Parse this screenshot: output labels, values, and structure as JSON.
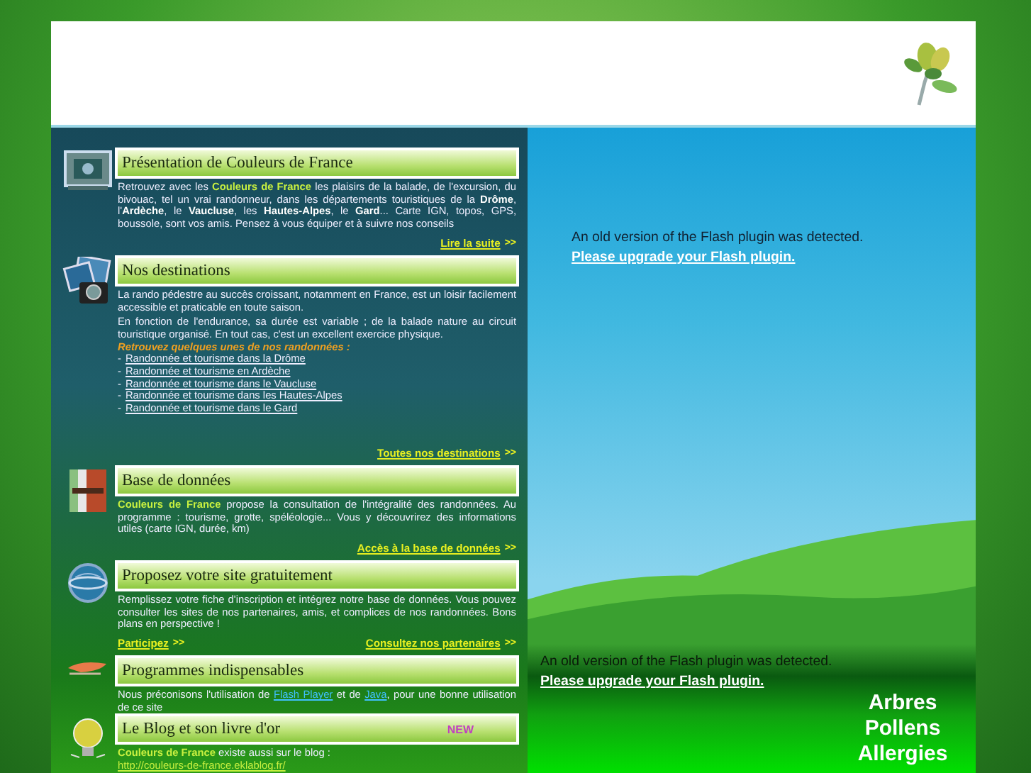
{
  "sections": [
    {
      "title": "Présentation de Couleurs de France",
      "paragraphs": [
        [
          {
            "kind": "plain",
            "text": "Retrouvez avec les "
          },
          {
            "kind": "brand",
            "text": "Couleurs de France"
          },
          {
            "kind": "plain",
            "text": " les plaisirs de la balade, de l'excursion, du bivouac, tel un vrai randonneur, dans les départements touristiques de la "
          },
          {
            "kind": "bold",
            "text": "Drôme"
          },
          {
            "kind": "plain",
            "text": ", l'"
          },
          {
            "kind": "bold",
            "text": "Ardèche"
          },
          {
            "kind": "plain",
            "text": ", le "
          },
          {
            "kind": "bold",
            "text": "Vaucluse"
          },
          {
            "kind": "plain",
            "text": ", les "
          },
          {
            "kind": "bold",
            "text": "Hautes-Alpes"
          },
          {
            "kind": "plain",
            "text": ", le "
          },
          {
            "kind": "bold",
            "text": "Gard"
          },
          {
            "kind": "plain",
            "text": "... Carte IGN, topos, GPS, boussole, sont vos amis. Pensez à vous équiper et à suivre nos conseils"
          }
        ]
      ],
      "links": [
        {
          "text": "Lire la suite",
          "arrow": ">>"
        }
      ]
    },
    {
      "title": "Nos destinations",
      "paragraphs": [
        [
          {
            "kind": "plain",
            "text": "La rando pédestre au succès croissant, notamment en France, est un loisir facilement accessible et praticable en toute saison."
          }
        ],
        [
          {
            "kind": "plain",
            "text": "En fonction de l'endurance, sa durée est variable ; de la balade nature au circuit touristique organisé. En tout cas, c'est un excellent exercice physique."
          }
        ]
      ],
      "list_heading": "Retrouvez quelques unes de nos randonnées :",
      "list": [
        {
          "bullet": "-",
          "text": "Randonnée et tourisme dans la Drôme"
        },
        {
          "bullet": "-",
          "text": "Randonnée et tourisme en Ardèche"
        },
        {
          "bullet": "-",
          "text": "Randonnée et tourisme dans le Vaucluse"
        },
        {
          "bullet": "-",
          "text": "Randonnée et tourisme dans les Hautes-Alpes"
        },
        {
          "bullet": "-",
          "text": "Randonnée et tourisme dans le Gard"
        }
      ],
      "links": [
        {
          "text": "Toutes nos destinations",
          "arrow": ">>"
        }
      ]
    },
    {
      "title": "Base de données",
      "paragraphs": [
        [
          {
            "kind": "brand",
            "text": "Couleurs de France"
          },
          {
            "kind": "plain",
            "text": " propose la consultation de l'intégralité des randonnées. Au programme : tourisme, grotte, spéléologie... Vous y découvrirez des informations utiles (carte IGN, durée, km)"
          }
        ]
      ],
      "links": [
        {
          "text": "Accès à la base de données",
          "arrow": ">>"
        }
      ]
    },
    {
      "title": "Proposez votre site gratuitement",
      "paragraphs": [
        [
          {
            "kind": "plain",
            "text": "Remplissez votre fiche d'inscription et intégrez notre base de données. Vous pouvez consulter les sites de nos partenaires, amis, et complices de nos randonnées. Bons plans en perspective !"
          }
        ]
      ],
      "links": [
        {
          "text": "Participez",
          "arrow": ">>"
        },
        {
          "text": "Consultez nos partenaires",
          "arrow": ">>"
        }
      ]
    },
    {
      "title": "Programmes indispensables",
      "paragraphs": [
        [
          {
            "kind": "plain",
            "text": "Nous préconisons l'utilisation de "
          },
          {
            "kind": "link",
            "text": "Flash Player"
          },
          {
            "kind": "plain",
            "text": " et de "
          },
          {
            "kind": "link",
            "text": "Java"
          },
          {
            "kind": "plain",
            "text": ", pour une bonne utilisation de ce site"
          }
        ]
      ]
    },
    {
      "title": "Le Blog et son livre d'or",
      "badge": "NEW",
      "paragraphs": [
        [
          {
            "kind": "brand",
            "text": "Couleurs de France"
          },
          {
            "kind": "plain",
            "text": " existe aussi sur le blog :"
          }
        ]
      ],
      "url": "http://couleurs-de-france.eklablog.fr/"
    }
  ],
  "flash_notices": [
    {
      "text": "An old version of the Flash plugin was detected.",
      "link": "Please upgrade your Flash plugin."
    },
    {
      "text": "An old version of the Flash plugin was detected.",
      "link": "Please upgrade your Flash plugin."
    }
  ],
  "logo_words": [
    "Arbres",
    "Pollens",
    "Allergies"
  ]
}
